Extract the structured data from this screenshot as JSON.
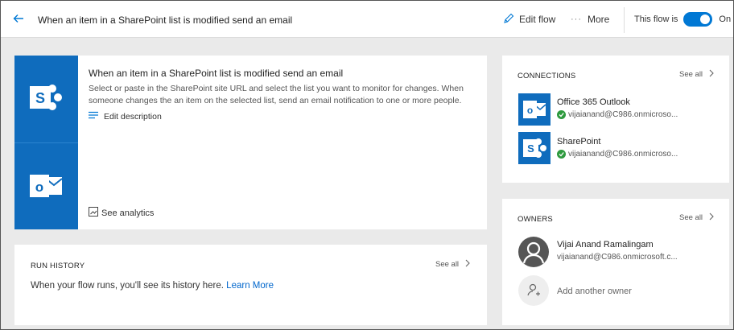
{
  "header": {
    "title": "When an item in a SharePoint list is modified send an email",
    "edit_flow": "Edit flow",
    "more": "More",
    "flow_status_label": "This flow is",
    "toggle_state": "On"
  },
  "flow": {
    "name": "When an item in a SharePoint list is modified send an email",
    "description": "Select or paste in the SharePoint site URL and select the list you want to monitor for changes. When someone changes the an item on the selected list, send an email notification to one or more people.",
    "edit_description": "Edit description",
    "see_analytics": "See analytics",
    "apps": [
      "sharepoint-icon",
      "outlook-icon"
    ]
  },
  "run_history": {
    "heading": "RUN HISTORY",
    "see_all": "See all",
    "message": "When your flow runs, you'll see its history here.",
    "learn_more": "Learn More"
  },
  "connections": {
    "heading": "CONNECTIONS",
    "see_all": "See all",
    "items": [
      {
        "name": "Office 365 Outlook",
        "account": "vijaianand@C986.onmicroso...",
        "icon": "outlook-icon"
      },
      {
        "name": "SharePoint",
        "account": "vijaianand@C986.onmicroso...",
        "icon": "sharepoint-icon"
      }
    ]
  },
  "owners": {
    "heading": "OWNERS",
    "see_all": "See all",
    "items": [
      {
        "name": "Vijai Anand Ramalingam",
        "email": "vijaianand@C986.onmicrosoft.c..."
      }
    ],
    "add_owner": "Add another owner"
  },
  "colors": {
    "accent": "#0078d4",
    "tile_blue": "#0f6cbd",
    "link": "#0066cc",
    "success": "#2e9a3e"
  }
}
